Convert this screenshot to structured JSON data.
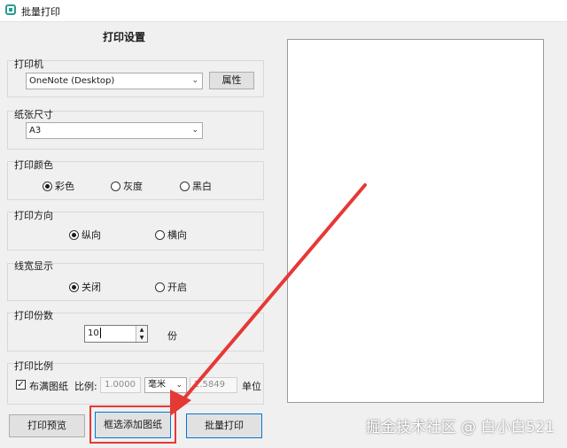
{
  "window": {
    "title": "批量打印"
  },
  "settings": {
    "title": "打印设置"
  },
  "printer": {
    "label": "打印机",
    "value": "OneNote (Desktop)",
    "properties_button": "属性"
  },
  "paper": {
    "label": "纸张尺寸",
    "value": "A3"
  },
  "color": {
    "label": "打印颜色",
    "options": [
      "彩色",
      "灰度",
      "黑白"
    ],
    "selected": "彩色"
  },
  "orientation": {
    "label": "打印方向",
    "options": [
      "纵向",
      "横向"
    ],
    "selected": "纵向"
  },
  "line_width": {
    "label": "线宽显示",
    "options": [
      "关闭",
      "开启"
    ],
    "selected": "关闭"
  },
  "copies": {
    "label": "打印份数",
    "value": "10",
    "unit": "份"
  },
  "scale": {
    "label": "打印比例",
    "fill_paper_label": "布满图纸",
    "fill_paper_checked": true,
    "ratio_label": "比例:",
    "ratio_value": "1.0000",
    "unit_select": "毫米",
    "value2": "2.5849",
    "unit_label": "单位"
  },
  "buttons": {
    "preview": "打印预览",
    "add_drawings": "框选添加图纸",
    "batch_print": "批量打印"
  },
  "watermark": "掘金技术社区 @ 白小白521",
  "colors": {
    "annotation_red": "#e53935",
    "accent": "#2a9d8f"
  }
}
